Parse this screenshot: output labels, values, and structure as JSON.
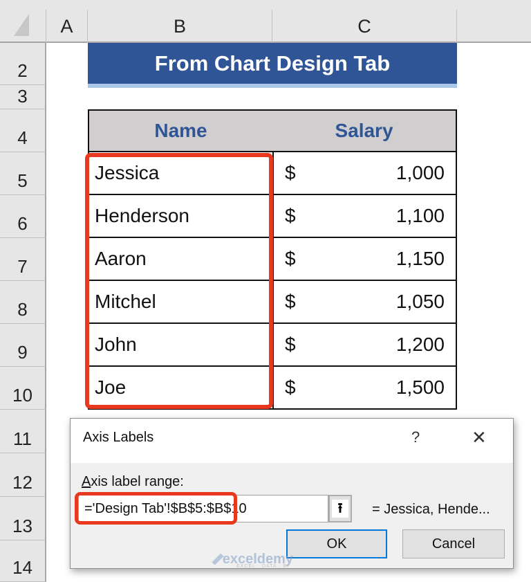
{
  "spreadsheet": {
    "columns": [
      "A",
      "B",
      "C"
    ],
    "rows": [
      "2",
      "3",
      "4",
      "5",
      "6",
      "7",
      "8",
      "9",
      "10",
      "11",
      "12",
      "13",
      "14"
    ],
    "title": "From Chart Design Tab",
    "table": {
      "headers": [
        "Name",
        "Salary"
      ],
      "currency_symbol": "$",
      "rows": [
        {
          "name": "Jessica",
          "salary": "1,000"
        },
        {
          "name": "Henderson",
          "salary": "1,100"
        },
        {
          "name": "Aaron",
          "salary": "1,150"
        },
        {
          "name": "Mitchel",
          "salary": "1,050"
        },
        {
          "name": "John",
          "salary": "1,200"
        },
        {
          "name": "Joe",
          "salary": "1,500"
        }
      ]
    }
  },
  "dialog": {
    "title": "Axis Labels",
    "help_label": "?",
    "close_label": "✕",
    "field_label_accel": "A",
    "field_label_rest": "xis label range:",
    "range_value": "='Design Tab'!$B$5:$B$10",
    "collapse_icon": "⭱",
    "preview": "= Jessica, Hende...",
    "ok_label": "OK",
    "cancel_label": "Cancel"
  },
  "watermark": {
    "text": "exceldemy",
    "subtext": "EXCEL · DATA · BI"
  },
  "colors": {
    "title_bg": "#2f5597",
    "header_bg": "#d0cece",
    "highlight": "#e8391e",
    "ok_border": "#0078d7"
  }
}
